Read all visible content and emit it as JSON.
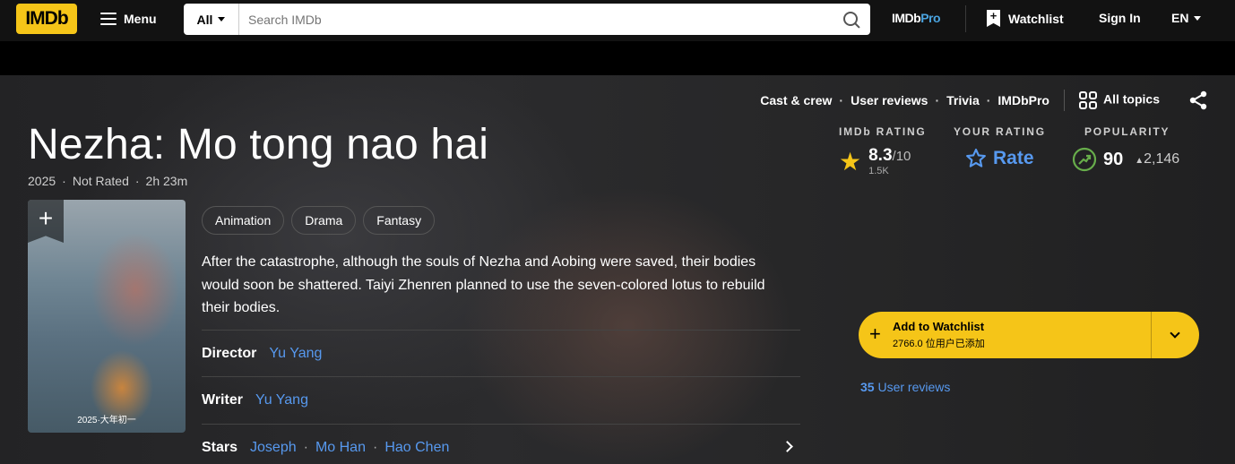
{
  "nav": {
    "logo": "IMDb",
    "menu_label": "Menu",
    "search_category": "All",
    "search_placeholder": "Search IMDb",
    "imdbpro_a": "IMDb",
    "imdbpro_b": "Pro",
    "watchlist_label": "Watchlist",
    "signin_label": "Sign In",
    "language": "EN"
  },
  "subnav": {
    "items": [
      "Cast & crew",
      "User reviews",
      "Trivia"
    ],
    "imdbpro": "IMDbPro",
    "all_topics": "All topics"
  },
  "movie": {
    "title": "Nezha: Mo tong nao hai",
    "year": "2025",
    "certificate": "Not Rated",
    "runtime": "2h 23m",
    "genres": [
      "Animation",
      "Drama",
      "Fantasy"
    ],
    "plot": "After the catastrophe, although the souls of Nezha and Aobing were saved, their bodies would soon be shattered. Taiyi Zhenren planned to use the seven-colored lotus to rebuild their bodies.",
    "poster_text": "2025·大年初一"
  },
  "ratings": {
    "imdb_label": "IMDb RATING",
    "imdb_value": "8.3",
    "imdb_scale": "/10",
    "imdb_votes": "1.5K",
    "your_label": "YOUR RATING",
    "rate_label": "Rate",
    "popularity_label": "POPULARITY",
    "popularity_value": "90",
    "popularity_change": "2,146"
  },
  "credits": {
    "director_label": "Director",
    "director": "Yu Yang",
    "writer_label": "Writer",
    "writer": "Yu Yang",
    "stars_label": "Stars",
    "stars": [
      "Joseph",
      "Mo Han",
      "Hao Chen"
    ]
  },
  "watchlist": {
    "add_label": "Add to Watchlist",
    "added_count": "2766.0 位用户已添加"
  },
  "reviews": {
    "count": "35",
    "label": "User reviews"
  },
  "colors": {
    "imdb_yellow": "#f5c518",
    "link_blue": "#5799ef",
    "popularity_green": "#67ad4b"
  }
}
